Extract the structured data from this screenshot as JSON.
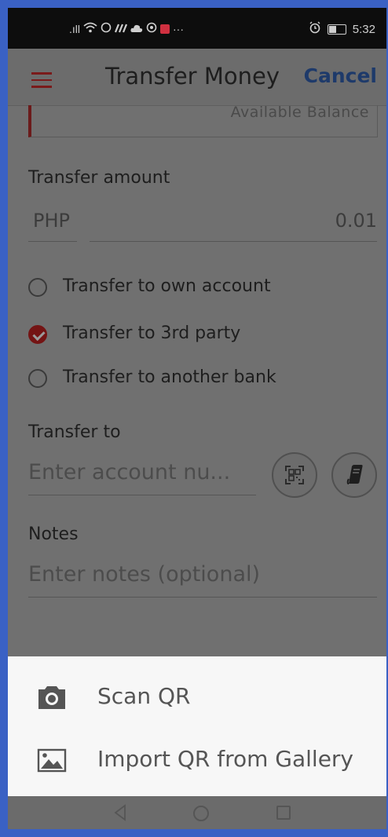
{
  "status_bar": {
    "signal_text": ".ıll",
    "time": "5:32",
    "more": "···"
  },
  "header": {
    "title": "Transfer Money",
    "cancel_label": "Cancel"
  },
  "balance": {
    "label": "Available Balance"
  },
  "amount": {
    "label": "Transfer amount",
    "currency": "PHP",
    "value": "0.01"
  },
  "transfer_options": [
    {
      "label": "Transfer to own account",
      "checked": false
    },
    {
      "label": "Transfer to 3rd party",
      "checked": true
    },
    {
      "label": "Transfer to another bank",
      "checked": false
    }
  ],
  "transfer_to": {
    "label": "Transfer to",
    "placeholder": "Enter account nu..."
  },
  "notes": {
    "label": "Notes",
    "placeholder": "Enter notes (optional)"
  },
  "sheet": {
    "items": [
      {
        "label": "Scan QR",
        "icon": "camera-icon"
      },
      {
        "label": "Import QR from Gallery",
        "icon": "image-icon"
      }
    ]
  },
  "colors": {
    "accent": "#741414",
    "cancel": "#1e3a6a",
    "frame": "#3a61c4"
  }
}
